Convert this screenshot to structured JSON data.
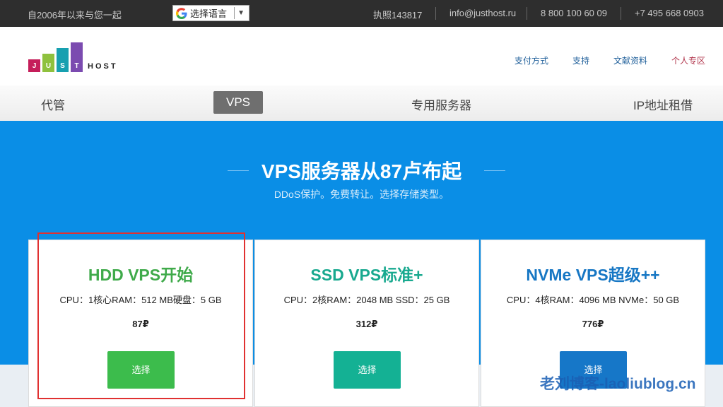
{
  "topbar": {
    "since": "自2006年以来与您一起",
    "language_label": "选择语言",
    "license": "执照143817",
    "email": "info@justhost.ru",
    "phone1": "8 800 100 60 09",
    "phone2": "+7 495 668 0903"
  },
  "logo": {
    "letters": [
      "J",
      "U",
      "S",
      "T"
    ],
    "host": "HOST",
    "colors": [
      "#c51e5a",
      "#8fc13e",
      "#17a0b0",
      "#7b4bb0"
    ]
  },
  "header_nav": [
    "支付方式",
    "支持",
    "文献资料",
    "个人专区"
  ],
  "main_nav": {
    "items": [
      "代管",
      "VPS",
      "专用服务器",
      "IP地址租借"
    ],
    "active": "VPS"
  },
  "hero": {
    "title": "VPS服务器从87卢布起",
    "subtitle": "DDoS保护。免费转让。选择存储类型。"
  },
  "plans": [
    {
      "title": "HDD VPS开始",
      "spec": "CPU：1核心RAM：512 MB硬盘：5 GB",
      "price": "87₽",
      "button": "选择",
      "title_color": "#3faa4a",
      "button_color": "#3cbc4c"
    },
    {
      "title": "SSD VPS标准+",
      "spec": "CPU：2核RAM：2048 MB SSD：25 GB",
      "price": "312₽",
      "button": "选择",
      "title_color": "#18a98f",
      "button_color": "#14b194"
    },
    {
      "title": "NVMe VPS超级++",
      "spec": "CPU：4核RAM：4096 MB NVMe：50 GB",
      "price": "776₽",
      "button": "选择",
      "title_color": "#1777c4",
      "button_color": "#1677c8"
    }
  ],
  "watermark": "老刘博客-laoliublog.cn"
}
